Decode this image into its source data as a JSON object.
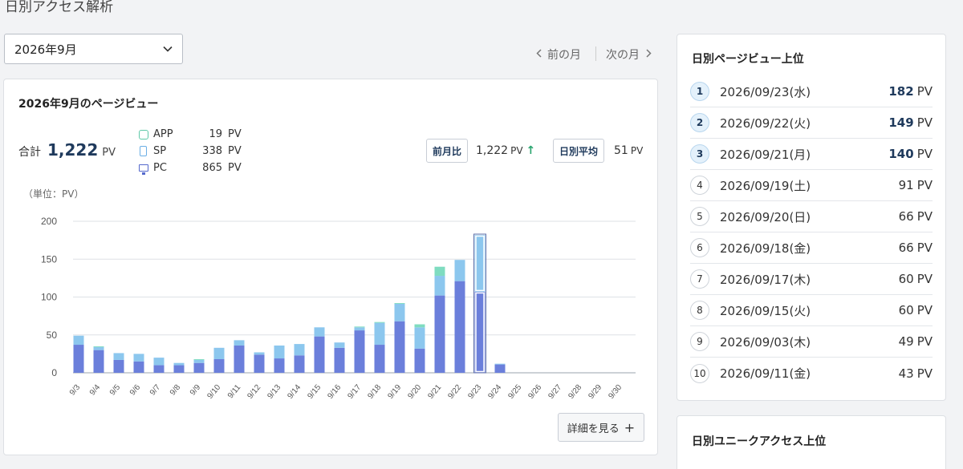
{
  "page": {
    "heading": "日別アクセス解析"
  },
  "month_select": {
    "value": "2026年9月"
  },
  "month_nav": {
    "prev": "前の月",
    "next": "次の月",
    "prev_icon": "chevron-left-icon",
    "next_icon": "chevron-right-icon"
  },
  "main_card": {
    "title": "2026年9月のページビュー",
    "total_label": "合計",
    "total_value": "1,222",
    "unit": "PV",
    "legend": [
      {
        "label": "APP",
        "value": "19",
        "unit": "PV",
        "icon": "app-icon",
        "color": "#7fdcc0"
      },
      {
        "label": "SP",
        "value": "338",
        "unit": "PV",
        "icon": "smartphone-icon",
        "color": "#8cc7ee"
      },
      {
        "label": "PC",
        "value": "865",
        "unit": "PV",
        "icon": "desktop-icon",
        "color": "#6b7fdb"
      }
    ],
    "prev_month_label": "前月比",
    "prev_month_value": "1,222",
    "prev_month_unit": "PV",
    "prev_month_trend": "↑",
    "daily_avg_label": "日別平均",
    "daily_avg_value": "51",
    "daily_avg_unit": "PV",
    "unit_note": "（単位：PV）",
    "detail_button": "詳細を見る",
    "detail_icon": "plus-icon"
  },
  "chart_data": {
    "type": "bar",
    "stacked": true,
    "categories": [
      "9/3",
      "9/4",
      "9/5",
      "9/6",
      "9/7",
      "9/8",
      "9/9",
      "9/10",
      "9/11",
      "9/12",
      "9/13",
      "9/14",
      "9/15",
      "9/16",
      "9/17",
      "9/18",
      "9/19",
      "9/20",
      "9/21",
      "9/22",
      "9/23",
      "9/24",
      "9/25",
      "9/26",
      "9/27",
      "9/28",
      "9/29",
      "9/30"
    ],
    "series": [
      {
        "name": "PC",
        "color": "#6b7fdb",
        "values": [
          37,
          30,
          17,
          15,
          10,
          10,
          13,
          18,
          36,
          24,
          19,
          23,
          48,
          33,
          56,
          37,
          68,
          32,
          102,
          121,
          107,
          11,
          0,
          0,
          0,
          0,
          0,
          0
        ]
      },
      {
        "name": "SP",
        "color": "#8cc7ee",
        "values": [
          12,
          4,
          9,
          10,
          10,
          3,
          4,
          15,
          7,
          3,
          17,
          15,
          12,
          7,
          4,
          29,
          23,
          28,
          26,
          28,
          75,
          1,
          0,
          0,
          0,
          0,
          0,
          0
        ]
      },
      {
        "name": "APP",
        "color": "#7fdcc0",
        "values": [
          0,
          1,
          0,
          0,
          0,
          0,
          1,
          0,
          0,
          0,
          0,
          0,
          0,
          0,
          1,
          1,
          1,
          4,
          12,
          0,
          0,
          0,
          0,
          0,
          0,
          0,
          0,
          0
        ]
      }
    ],
    "ylim": [
      0,
      200
    ],
    "yticks": [
      0,
      50,
      100,
      150,
      200
    ],
    "highlighted_category": "9/23",
    "grid": true
  },
  "pv_ranking": {
    "title": "日別ページビュー上位",
    "unit": "PV",
    "items": [
      {
        "rank": "1",
        "date": "2026/09/23(水)",
        "pv": "182"
      },
      {
        "rank": "2",
        "date": "2026/09/22(火)",
        "pv": "149"
      },
      {
        "rank": "3",
        "date": "2026/09/21(月)",
        "pv": "140"
      },
      {
        "rank": "4",
        "date": "2026/09/19(土)",
        "pv": "91"
      },
      {
        "rank": "5",
        "date": "2026/09/20(日)",
        "pv": "66"
      },
      {
        "rank": "6",
        "date": "2026/09/18(金)",
        "pv": "66"
      },
      {
        "rank": "7",
        "date": "2026/09/17(木)",
        "pv": "60"
      },
      {
        "rank": "8",
        "date": "2026/09/15(火)",
        "pv": "60"
      },
      {
        "rank": "9",
        "date": "2026/09/03(木)",
        "pv": "49"
      },
      {
        "rank": "10",
        "date": "2026/09/11(金)",
        "pv": "43"
      }
    ]
  },
  "ua_ranking": {
    "title": "日別ユニークアクセス上位"
  }
}
